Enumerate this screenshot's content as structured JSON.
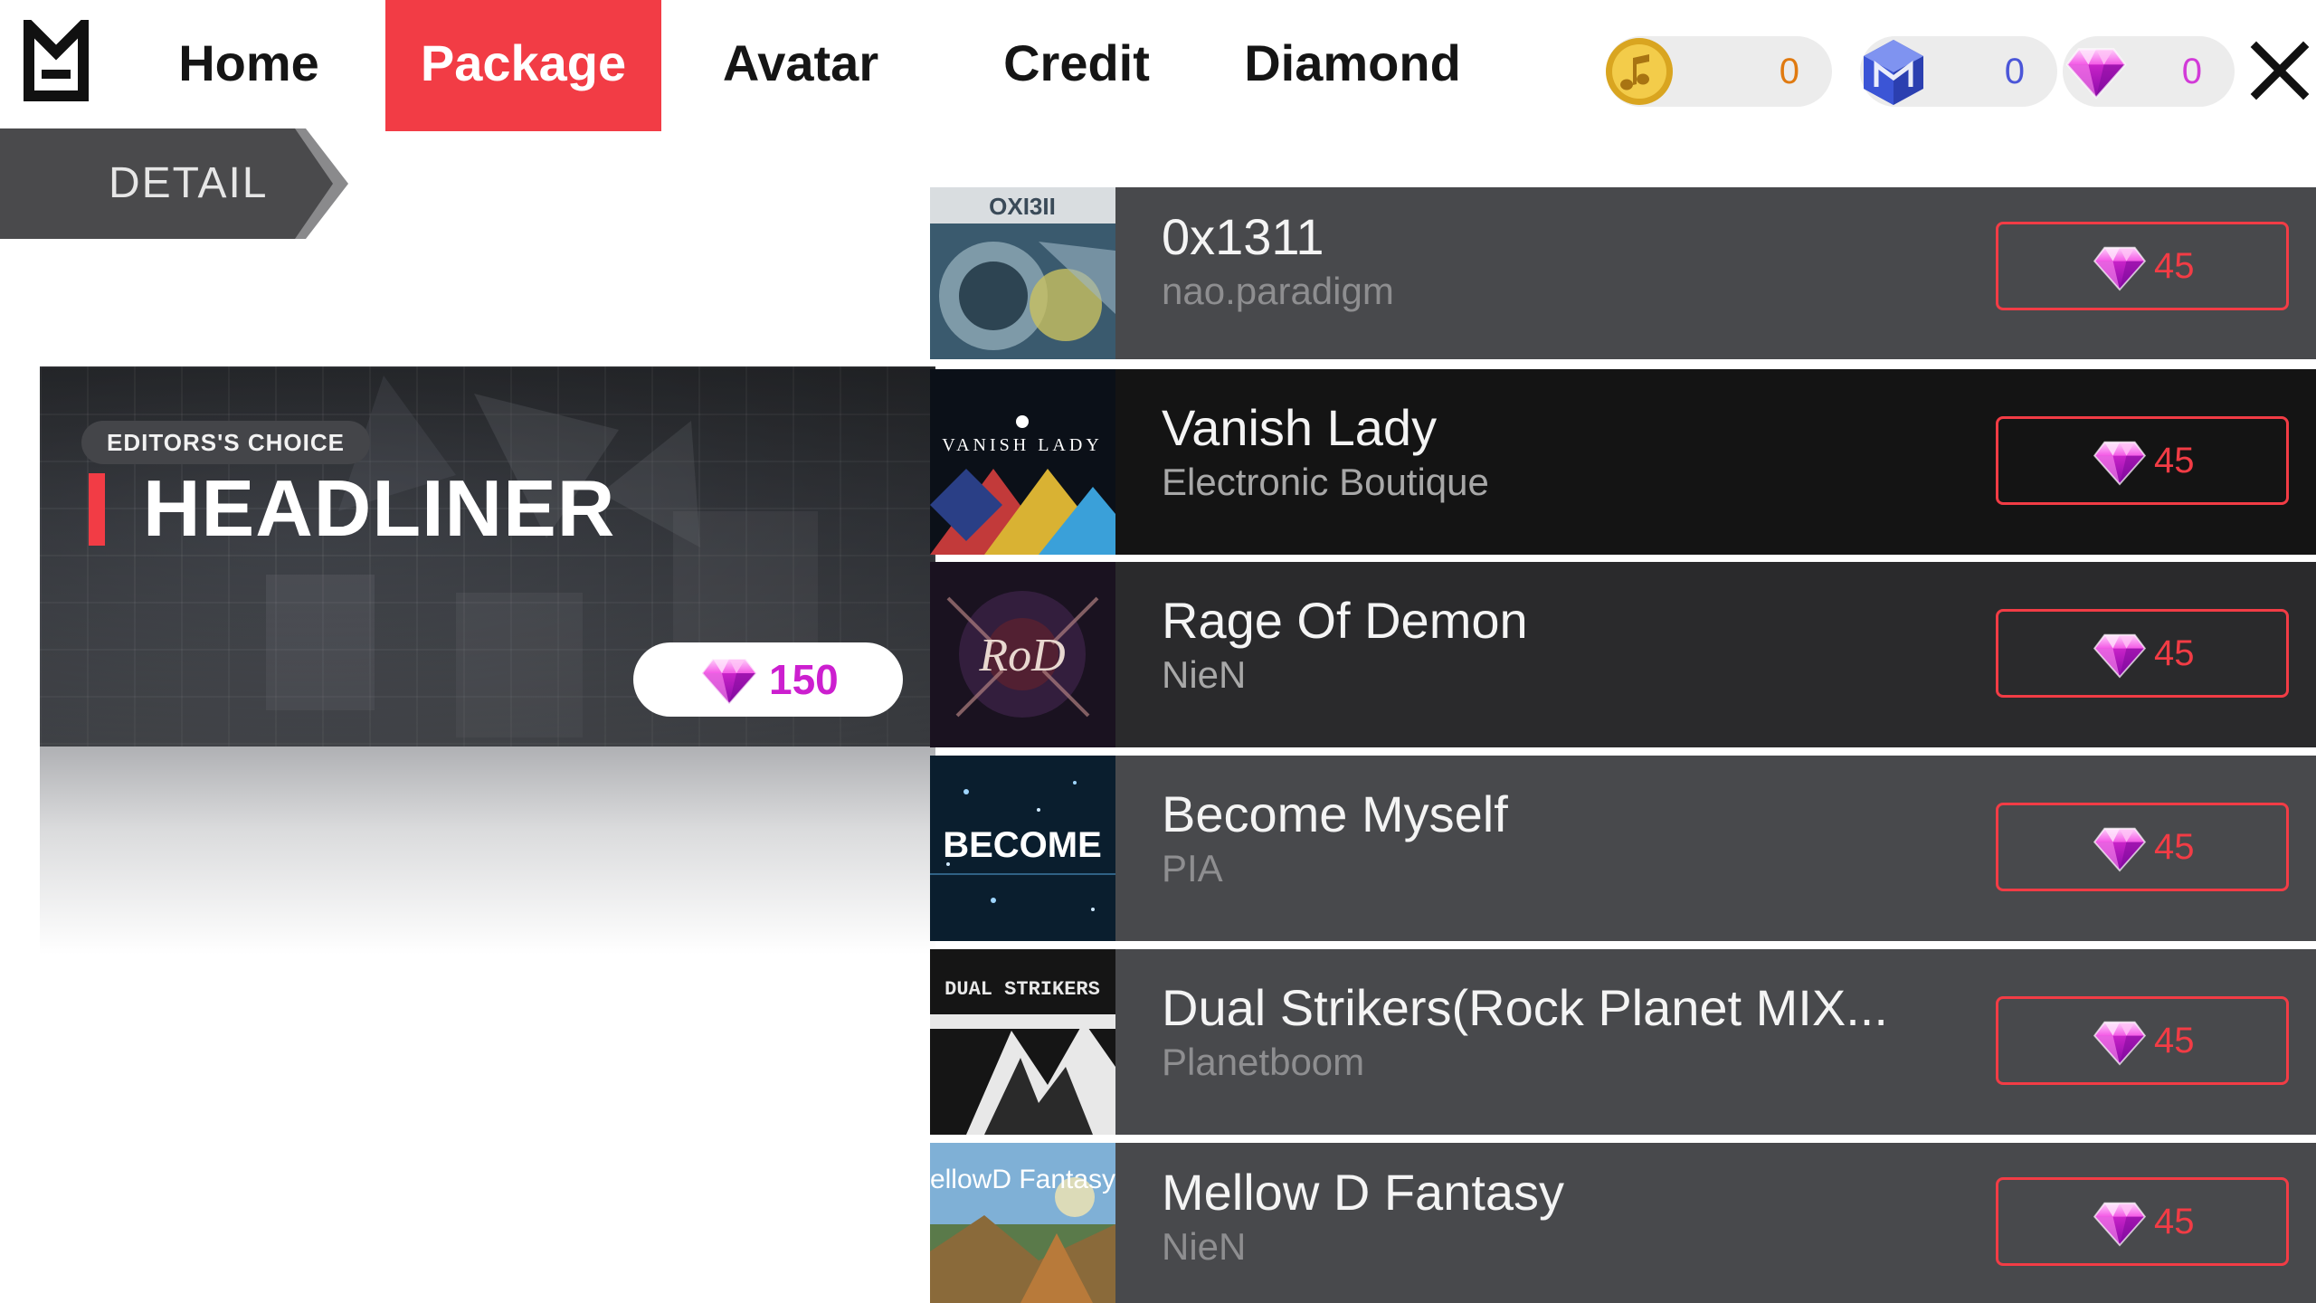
{
  "nav": {
    "tabs": [
      {
        "label": "Home"
      },
      {
        "label": "Package"
      },
      {
        "label": "Avatar"
      },
      {
        "label": "Credit"
      },
      {
        "label": "Diamond"
      }
    ],
    "active_tab": "Package"
  },
  "currencies": [
    {
      "icon": "music-coin-icon",
      "value": "0",
      "color": "#e07a10"
    },
    {
      "icon": "m-cube-icon",
      "value": "0",
      "color": "#4b56d8"
    },
    {
      "icon": "diamond-icon",
      "value": "0",
      "color": "#d23ad8"
    }
  ],
  "detail_tab": {
    "label": "DETAIL"
  },
  "headliner": {
    "badge": "EDITORS'S CHOICE",
    "title": "HEADLINER",
    "price": "150"
  },
  "songs": [
    {
      "title": "0x1311",
      "artist": "nao.paradigm",
      "price": "45",
      "cover_text": "OXI3II"
    },
    {
      "title": "Vanish Lady",
      "artist": "Electronic Boutique",
      "price": "45",
      "cover_text": "VANISH LADY"
    },
    {
      "title": "Rage Of Demon",
      "artist": "NieN",
      "price": "45",
      "cover_text": "RoD"
    },
    {
      "title": "Become Myself",
      "artist": "PIA",
      "price": "45",
      "cover_text": "BECOME"
    },
    {
      "title": "Dual Strikers(Rock Planet MIX...",
      "artist": "Planetboom",
      "price": "45",
      "cover_text": "DUAL STRIKERS"
    },
    {
      "title": "Mellow D Fantasy",
      "artist": "NieN",
      "price": "45",
      "cover_text": "MellowD Fantasy"
    }
  ],
  "colors": {
    "accent": "#f23c45",
    "diamond": "#d23ad8",
    "row_dark": "#141414",
    "row": "#48494c"
  }
}
